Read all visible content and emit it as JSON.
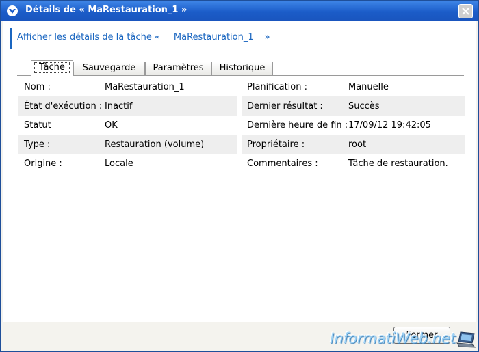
{
  "window": {
    "title": "Détails de « MaRestauration_1 »"
  },
  "heading": {
    "prefix": "Afficher les détails de la tâche «",
    "task_name": "MaRestauration_1",
    "suffix": "»"
  },
  "tabs": [
    {
      "label": "Tâche",
      "active": true
    },
    {
      "label": "Sauvegarde",
      "active": false
    },
    {
      "label": "Paramètres",
      "active": false
    },
    {
      "label": "Historique",
      "active": false
    }
  ],
  "details": {
    "left": [
      {
        "label": "Nom :",
        "value": "MaRestauration_1"
      },
      {
        "label": "État d'exécution :",
        "value": "Inactif"
      },
      {
        "label": "Statut",
        "value": "OK"
      },
      {
        "label": "Type :",
        "value": "Restauration (volume)"
      },
      {
        "label": "Origine :",
        "value": "Locale"
      }
    ],
    "right": [
      {
        "label": "Planification :",
        "value": "Manuelle"
      },
      {
        "label": "Dernier résultat :",
        "value": "Succès"
      },
      {
        "label": "Dernière heure de fin :",
        "value": "17/09/12 19:42:05"
      },
      {
        "label": "Propriétaire :",
        "value": "root"
      },
      {
        "label": "Commentaires :",
        "value": "Tâche de restauration."
      }
    ]
  },
  "footer": {
    "close_label": "Fermer"
  },
  "watermark": {
    "text": "InformatiWeb.net"
  },
  "colors": {
    "titlebar": "#1b5cc8",
    "accent": "#1a66c0",
    "row_shade": "#eeeeee"
  }
}
